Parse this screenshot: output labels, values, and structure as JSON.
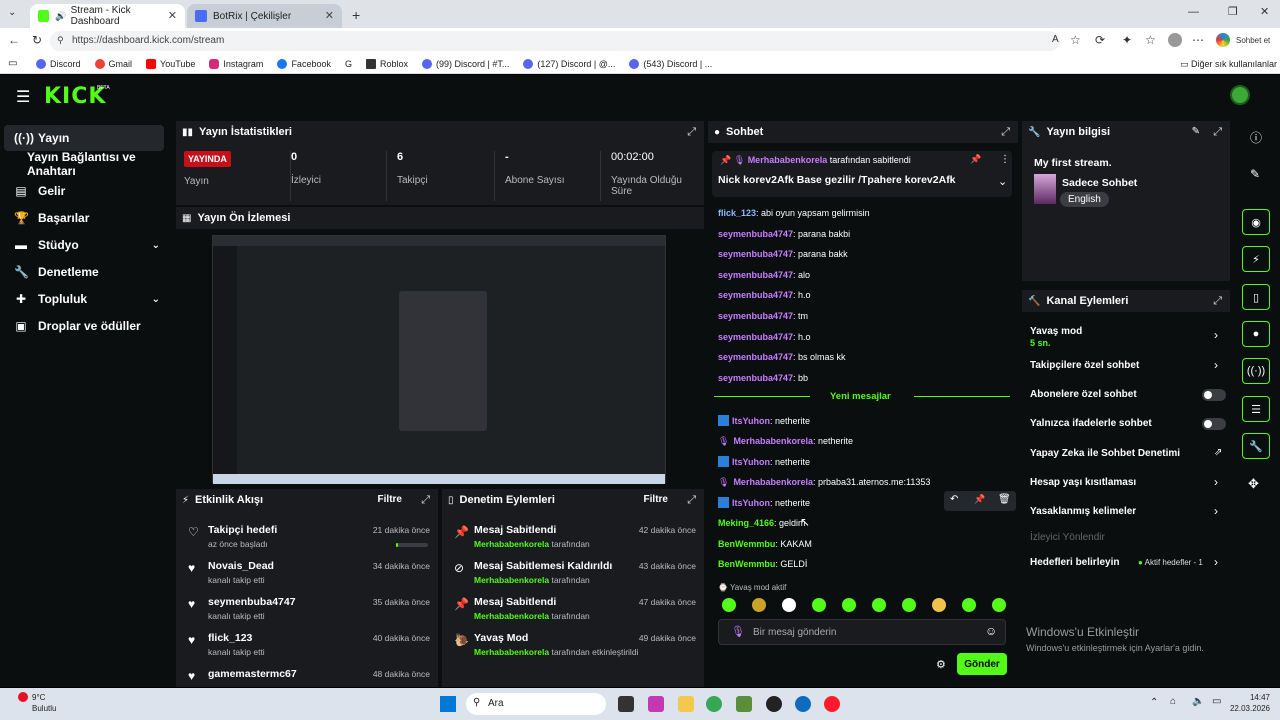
{
  "browser": {
    "tabs": [
      {
        "title": "Stream - Kick Dashboard"
      },
      {
        "title": "BotRix | Çekilişler"
      }
    ],
    "url": "https://dashboard.kick.com/stream",
    "bookmarks": [
      "Discord",
      "Gmail",
      "YouTube",
      "Instagram",
      "Facebook",
      "G",
      "Roblox",
      "(99) Discord | #T...",
      "(127) Discord | @...",
      "(543) Discord | ..."
    ],
    "other_bookmarks": "Diğer sık kullanılanlar",
    "profile_label": "Sohbet et"
  },
  "kick": {
    "logo": "KICK",
    "beta": "BETA",
    "sidebar": [
      {
        "label": "Yayın",
        "icon": "broadcast-icon"
      },
      {
        "label": "Yayın Bağlantısı ve Anahtarı",
        "icon": ""
      },
      {
        "label": "Gelir",
        "icon": "chart-icon"
      },
      {
        "label": "Başarılar",
        "icon": "trophy-icon"
      },
      {
        "label": "Stüdyo",
        "icon": "studio-icon"
      },
      {
        "label": "Denetleme",
        "icon": "wrench-icon"
      },
      {
        "label": "Topluluk",
        "icon": "community-icon"
      },
      {
        "label": "Droplar ve ödüller",
        "icon": "gift-icon"
      }
    ],
    "stats": {
      "title": "Yayın İstatistikleri",
      "live_badge": "YAYINDA",
      "live_label": "Yayın",
      "viewers_value": "0",
      "viewers_label": "İzleyici",
      "followers_value": "6",
      "followers_label": "Takipçi",
      "subs_value": "-",
      "subs_label": "Abone Sayısı",
      "uptime_value": "00:02:00",
      "uptime_label": "Yayında Olduğu Süre"
    },
    "preview": {
      "title": "Yayın Ön İzlemesi"
    },
    "activity": {
      "title": "Etkinlik Akışı",
      "filter": "Filtre",
      "items": [
        {
          "title": "Takipçi hedefi",
          "sub": "az önce başladı",
          "time": "21 dakika önce",
          "progress": 0.06
        },
        {
          "title": "Novais_Dead",
          "sub": "kanalı takip etti",
          "time": "34 dakika önce"
        },
        {
          "title": "seymenbuba4747",
          "sub": "kanalı takip etti",
          "time": "35 dakika önce"
        },
        {
          "title": "flick_123",
          "sub": "kanalı takip etti",
          "time": "40 dakika önce"
        },
        {
          "title": "gamemastermc67",
          "sub": "",
          "time": "48 dakika önce"
        }
      ]
    },
    "mod_actions": {
      "title": "Denetim Eylemleri",
      "filter": "Filtre",
      "items": [
        {
          "title": "Mesaj Sabitlendi",
          "user": "Merhababenkorela",
          "suffix": "tarafından",
          "time": "42 dakika önce"
        },
        {
          "title": "Mesaj Sabitlemesi Kaldırıldı",
          "user": "Merhababenkorela",
          "suffix": "tarafından",
          "time": "43 dakika önce"
        },
        {
          "title": "Mesaj Sabitlendi",
          "user": "Merhababenkorela",
          "suffix": "tarafından",
          "time": "47 dakika önce"
        },
        {
          "title": "Yavaş Mod",
          "user": "Merhababenkorela",
          "suffix": "tarafından etkinleştirildi",
          "time": "49 dakika önce"
        }
      ]
    },
    "chat": {
      "title": "Sohbet",
      "pinned_by_user": "Merhababenkorela",
      "pinned_by_suffix": "tarafından sabitlendi",
      "pinned_text": "Nick korev2Afk Base gezilir /Tpahere korev2Afk",
      "messages": [
        {
          "user": "flick_123",
          "text": ": abi oyun yapsam gelirmisin",
          "color": "#8fb8ff"
        },
        {
          "user": "seymenbuba4747",
          "text": ": parana bakbi",
          "color": "#c77dff"
        },
        {
          "user": "seymenbuba4747",
          "text": ": parana bakk",
          "color": "#c77dff"
        },
        {
          "user": "seymenbuba4747",
          "text": ": alo",
          "color": "#c77dff"
        },
        {
          "user": "seymenbuba4747",
          "text": ": h.o",
          "color": "#c77dff"
        },
        {
          "user": "seymenbuba4747",
          "text": ": tm",
          "color": "#c77dff"
        },
        {
          "user": "seymenbuba4747",
          "text": ": h.o",
          "color": "#c77dff"
        },
        {
          "user": "seymenbuba4747",
          "text": ": bs olmas kk",
          "color": "#c77dff"
        },
        {
          "user": "seymenbuba4747",
          "text": ": bb",
          "color": "#c77dff"
        }
      ],
      "new_messages": "Yeni mesajlar",
      "messages2": [
        {
          "user": "ItsYuhon",
          "text": ": netherite",
          "color": "#c77dff",
          "badge": "sword"
        },
        {
          "user": "Merhababenkorela",
          "text": ": netherite",
          "color": "#c77dff",
          "badge": "mic"
        },
        {
          "user": "ItsYuhon",
          "text": ": netherite",
          "color": "#c77dff",
          "badge": "sword"
        },
        {
          "user": "Merhababenkorela",
          "text": ": prbaba31.aternos.me:11353",
          "color": "#c77dff",
          "badge": "mic"
        },
        {
          "user": "ItsYuhon",
          "text": ": netherite",
          "color": "#c77dff",
          "badge": "sword"
        },
        {
          "user": "Meking_4166",
          "text": ": geldim",
          "color": "#53fc18",
          "badge": ""
        },
        {
          "user": "BenWemmbu",
          "text": ": KAKAM",
          "color": "#53fc18",
          "badge": ""
        },
        {
          "user": "BenWemmbu",
          "text": ": GELDİ",
          "color": "#53fc18",
          "badge": ""
        }
      ],
      "slow_mode": "Yavaş mod aktif",
      "input_placeholder": "Bir mesaj gönderin",
      "send": "Gönder"
    },
    "stream_info": {
      "title": "Yayın bilgisi",
      "stream_title": "My first stream.",
      "category": "Sadece Sohbet",
      "language": "English"
    },
    "channel_actions": {
      "title": "Kanal Eylemleri",
      "slow_mode": "Yavaş mod",
      "slow_value": "5 sn.",
      "followers_only": "Takipçilere özel sohbet",
      "subs_only": "Abonelere özel sohbet",
      "emotes_only": "Yalnızca ifadelerle sohbet",
      "ai_mod": "Yapay Zeka ile Sohbet Denetimi",
      "age": "Hesap yaşı kısıtlaması",
      "banned_words": "Yasaklanmış kelimeler",
      "viewer_redirect": "İzleyici Yönlendir",
      "goals": "Hedefleri belirleyin",
      "goals_status": "Aktif hedefler - 1"
    },
    "watermark": {
      "line1": "Windows'u Etkinleştir",
      "line2": "Windows'u etkinleştirmek için Ayarlar'a gidin."
    }
  },
  "taskbar": {
    "weather_temp": "9°C",
    "weather_desc": "Bulutlu",
    "search": "Ara",
    "time": "14:47",
    "date": "22.03.2026"
  }
}
